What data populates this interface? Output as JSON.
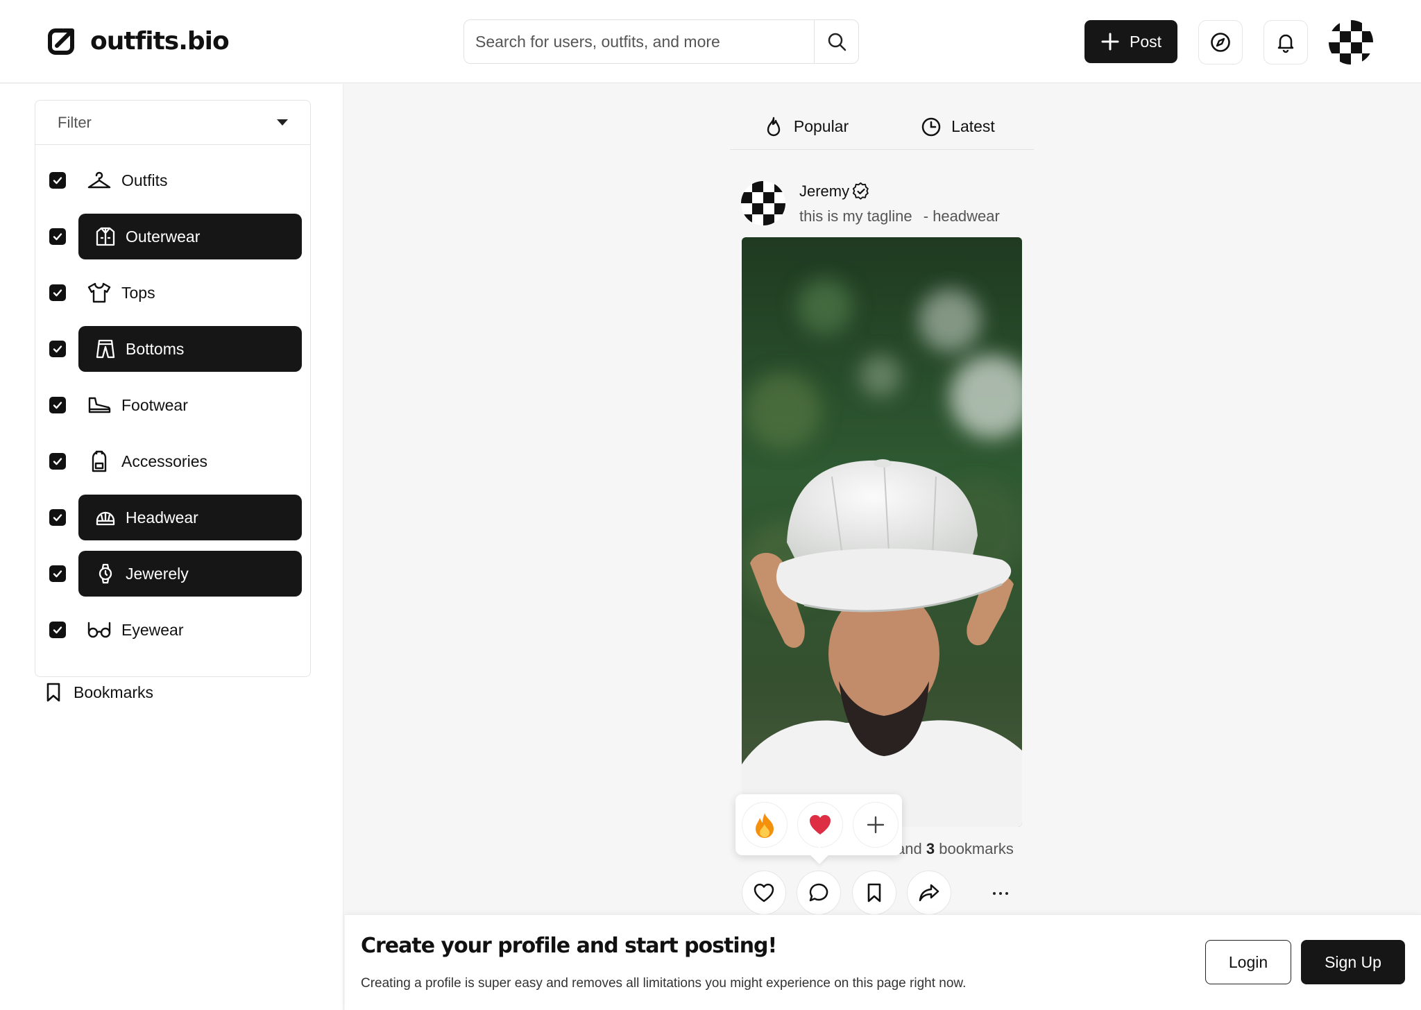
{
  "header": {
    "logo_text": "outfits.bio",
    "search_placeholder": "Search for users, outfits, and more",
    "post_label": "Post"
  },
  "sidebar": {
    "filter_label": "Filter",
    "categories": [
      {
        "label": "Outfits",
        "icon": "hanger-icon",
        "checked": true,
        "active": false
      },
      {
        "label": "Outerwear",
        "icon": "jacket-icon",
        "checked": true,
        "active": true
      },
      {
        "label": "Tops",
        "icon": "tshirt-icon",
        "checked": true,
        "active": false
      },
      {
        "label": "Bottoms",
        "icon": "pants-icon",
        "checked": true,
        "active": true
      },
      {
        "label": "Footwear",
        "icon": "shoe-icon",
        "checked": true,
        "active": false
      },
      {
        "label": "Accessories",
        "icon": "backpack-icon",
        "checked": true,
        "active": false
      },
      {
        "label": "Headwear",
        "icon": "cap-icon",
        "checked": true,
        "active": true
      },
      {
        "label": "Jewerely",
        "icon": "watch-icon",
        "checked": true,
        "active": true
      },
      {
        "label": "Eyewear",
        "icon": "glasses-icon",
        "checked": true,
        "active": false
      }
    ],
    "bookmarks_label": "Bookmarks"
  },
  "feed": {
    "tabs": [
      {
        "label": "Popular",
        "icon": "flame-icon"
      },
      {
        "label": "Latest",
        "icon": "clock-icon"
      }
    ],
    "post": {
      "author": "Jeremy",
      "tagline": "this is my tagline",
      "category_suffix": "- headwear",
      "stats_prefix": "and",
      "bookmark_count": "3",
      "stats_suffix": "bookmarks",
      "reactions": [
        "🔥",
        "❤️"
      ]
    }
  },
  "cta": {
    "title": "Create your profile and start posting!",
    "subtitle": "Creating a profile is super easy and removes all limitations you might experience on this page right now.",
    "login_label": "Login",
    "signup_label": "Sign Up"
  },
  "colors": {
    "primary": "#161616",
    "background": "#f6f6f6",
    "border": "#e3e3e3"
  }
}
